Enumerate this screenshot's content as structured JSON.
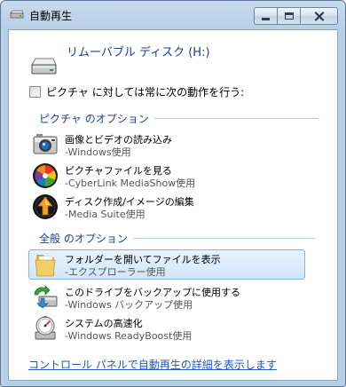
{
  "window": {
    "title": "自動再生"
  },
  "header": {
    "drive_title": "リムーバブル ディスク (H:)"
  },
  "checkbox": {
    "label": "ピクチャ に対しては常に次の動作を行う:",
    "checked": false
  },
  "sections": {
    "picture_options": "ピクチャ のオプション",
    "general_options": "全般 のオプション"
  },
  "picture_items": [
    {
      "title": "画像とビデオの読み込み",
      "subtitle": "-Windows使用",
      "icon": "camera-icon"
    },
    {
      "title": "ピクチャファイルを見る",
      "subtitle": "-CyberLink MediaShow使用",
      "icon": "mediashow-icon"
    },
    {
      "title": "ディスク作成/イメージの編集",
      "subtitle": "-Media Suite使用",
      "icon": "media-suite-icon"
    }
  ],
  "general_items": [
    {
      "title": "フォルダーを開いてファイルを表示",
      "subtitle": "-エクスプローラー使用",
      "icon": "folder-icon",
      "selected": true
    },
    {
      "title": "このドライブをバックアップに使用する",
      "subtitle": "-Windows バックアップ使用",
      "icon": "backup-icon"
    },
    {
      "title": "システムの高速化",
      "subtitle": "-Windows ReadyBoost使用",
      "icon": "readyboost-icon"
    }
  ],
  "footer": {
    "link": "コントロール パネルで自動再生の詳細を表示します"
  },
  "colors": {
    "accent_text": "#1f3d96",
    "link": "#1d58c9",
    "selection": "#d2e7fa"
  }
}
